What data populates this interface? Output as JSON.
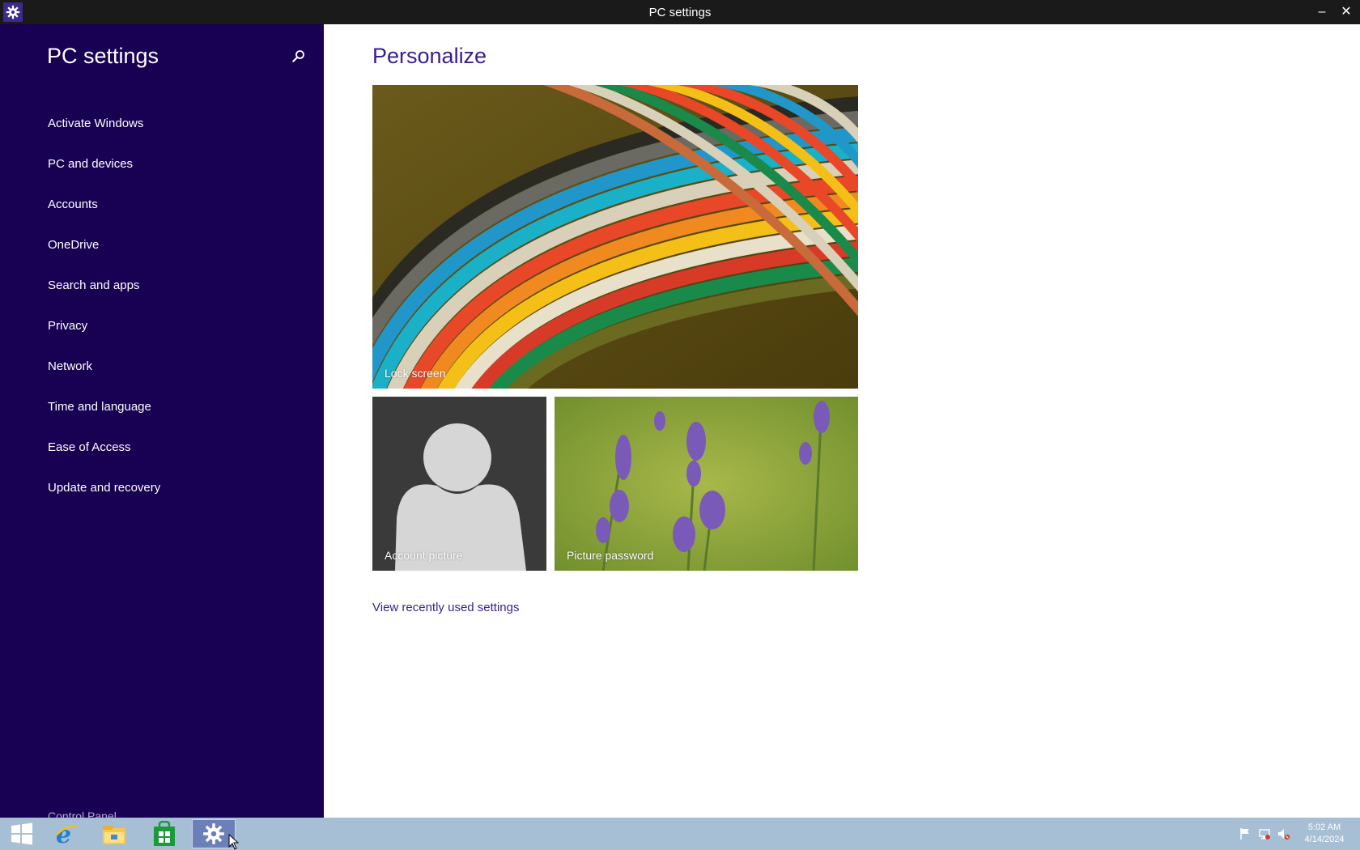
{
  "window": {
    "title": "PC settings",
    "minimize_icon": "minimize-icon",
    "close_icon": "close-icon"
  },
  "sidebar": {
    "heading": "PC settings",
    "search_icon": "search-icon",
    "items": [
      {
        "label": "Activate Windows"
      },
      {
        "label": "PC and devices"
      },
      {
        "label": "Accounts"
      },
      {
        "label": "OneDrive"
      },
      {
        "label": "Search and apps"
      },
      {
        "label": "Privacy"
      },
      {
        "label": "Network"
      },
      {
        "label": "Time and language"
      },
      {
        "label": "Ease of Access"
      },
      {
        "label": "Update and recovery"
      }
    ],
    "control_panel": "Control Panel"
  },
  "main": {
    "title": "Personalize",
    "tiles": {
      "lock_screen": "Lock screen",
      "account_picture": "Account picture",
      "picture_password": "Picture password"
    },
    "recent_link": "View recently used settings"
  },
  "taskbar": {
    "apps": [
      "start-icon",
      "internet-explorer-icon",
      "file-explorer-icon",
      "store-icon",
      "pc-settings-icon"
    ],
    "active_app": "pc-settings-icon",
    "tray_icons": [
      "action-center-flag-icon",
      "network-icon",
      "volume-muted-icon"
    ],
    "time": "5:02 AM",
    "date": "4/14/2024"
  },
  "colors": {
    "sidebar_bg": "#180052",
    "accent_text": "#3a1e8c",
    "titlebar_bg": "#1a1a1a",
    "taskbar_bg": "#a7bfd4"
  }
}
